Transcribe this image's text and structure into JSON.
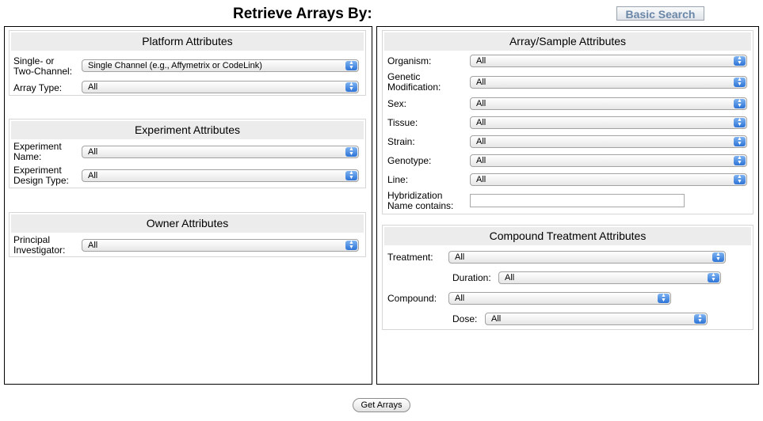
{
  "page": {
    "title": "Retrieve Arrays By:",
    "basic_search_label": "Basic Search",
    "submit_label": "Get Arrays"
  },
  "platform": {
    "heading": "Platform Attributes",
    "channel_label": "Single- or Two-Channel:",
    "channel_label_l1": "Single- or",
    "channel_label_l2": "Two-Channel:",
    "channel_value": "Single Channel (e.g., Affymetrix or CodeLink)",
    "array_type_label": "Array Type:",
    "array_type_value": "All"
  },
  "experiment": {
    "heading": "Experiment Attributes",
    "name_label_l1": "Experiment",
    "name_label_l2": "Name:",
    "name_value": "All",
    "design_label_l1": "Experiment",
    "design_label_l2": "Design Type:",
    "design_value": "All"
  },
  "owner": {
    "heading": "Owner Attributes",
    "pi_label_l1": "Principal",
    "pi_label_l2": "Investigator:",
    "pi_value": "All"
  },
  "sample": {
    "heading": "Array/Sample Attributes",
    "organism_label": "Organism:",
    "organism_value": "All",
    "genmod_label_l1": "Genetic",
    "genmod_label_l2": "Modification:",
    "genmod_value": "All",
    "sex_label": "Sex:",
    "sex_value": "All",
    "tissue_label": "Tissue:",
    "tissue_value": "All",
    "strain_label": "Strain:",
    "strain_value": "All",
    "genotype_label": "Genotype:",
    "genotype_value": "All",
    "line_label": "Line:",
    "line_value": "All",
    "hyb_label_l1": "Hybridization",
    "hyb_label_l2": "Name contains:",
    "hyb_value": ""
  },
  "compound": {
    "heading": "Compound Treatment Attributes",
    "treatment_label": "Treatment:",
    "treatment_value": "All",
    "duration_label": "Duration:",
    "duration_value": "All",
    "compound_label": "Compound:",
    "compound_value": "All",
    "dose_label": "Dose:",
    "dose_value": "All"
  },
  "icons": {
    "select_arrow": "updown-arrows-icon"
  }
}
